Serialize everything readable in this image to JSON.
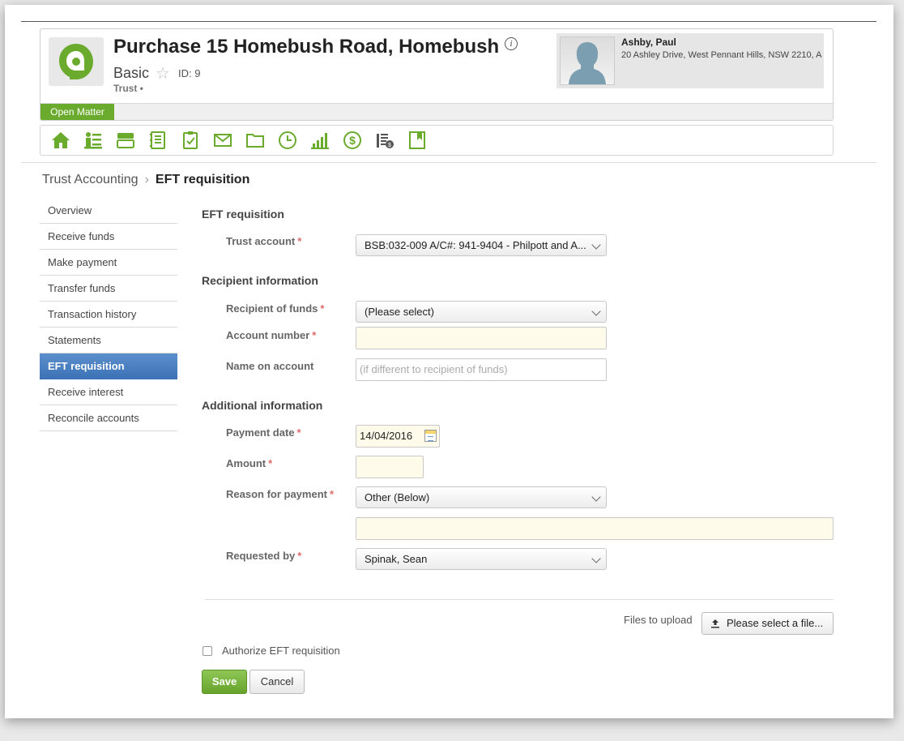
{
  "matter": {
    "title": "Purchase 15 Homebush Road, Homebush",
    "info_icon": "i",
    "type": "Basic",
    "id": "ID: 9",
    "subtitle": "Trust •",
    "status": "Open Matter"
  },
  "contact": {
    "name": "Ashby, Paul",
    "address": "20 Ashley Drive, West Pennant Hills, NSW 2210, A"
  },
  "toolbar": {
    "icons": [
      "home-icon",
      "contacts-icon",
      "cards-icon",
      "notes-icon",
      "tasks-icon",
      "mail-icon",
      "folder-icon",
      "clock-icon",
      "chart-icon",
      "dollar-icon",
      "accounts-icon",
      "bookmark-icon"
    ],
    "accent_color": "#6aab2e"
  },
  "breadcrumb": {
    "parent": "Trust Accounting",
    "separator": "›",
    "current": "EFT requisition"
  },
  "sidebar": {
    "items": [
      {
        "label": "Overview"
      },
      {
        "label": "Receive funds"
      },
      {
        "label": "Make payment"
      },
      {
        "label": "Transfer funds"
      },
      {
        "label": "Transaction history"
      },
      {
        "label": "Statements"
      },
      {
        "label": "EFT requisition",
        "active": true
      },
      {
        "label": "Receive interest"
      },
      {
        "label": "Reconcile accounts"
      }
    ]
  },
  "form": {
    "section_eft": "EFT requisition",
    "trust_account_label": "Trust account",
    "trust_account_value": "BSB:032-009 A/C#: 941-9404 - Philpott and A...",
    "section_recipient": "Recipient information",
    "recipient_label": "Recipient of funds",
    "recipient_value": "(Please select)",
    "account_number_label": "Account number",
    "account_number_value": "",
    "name_on_account_label": "Name on account",
    "name_on_account_placeholder": "(if different to recipient of funds)",
    "section_additional": "Additional information",
    "payment_date_label": "Payment date",
    "payment_date_value": "14/04/2016",
    "amount_label": "Amount",
    "amount_value": "",
    "reason_label": "Reason for payment",
    "reason_value": "Other (Below)",
    "reason_other_value": "",
    "requested_by_label": "Requested by",
    "requested_by_value": "Spinak, Sean",
    "required_marker": "*",
    "files_label": "Files to upload",
    "file_button": "Please select a file...",
    "authorize_label": "Authorize EFT requisition",
    "save_label": "Save",
    "cancel_label": "Cancel"
  }
}
